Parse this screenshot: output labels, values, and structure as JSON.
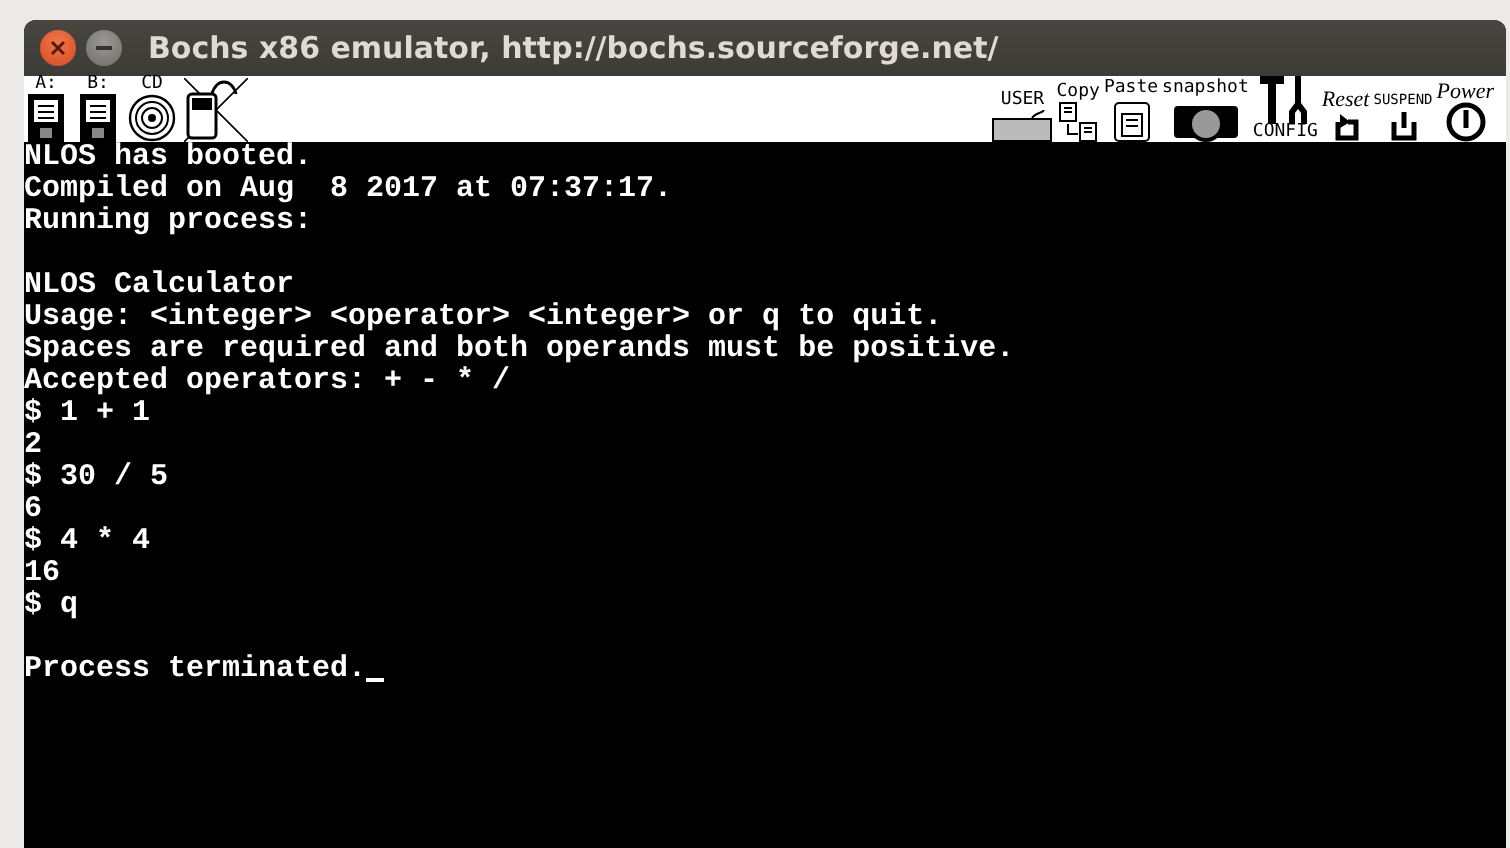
{
  "window": {
    "title": "Bochs x86 emulator, http://bochs.sourceforge.net/"
  },
  "toolbar": {
    "left": [
      {
        "kind": "floppy",
        "label": "A:"
      },
      {
        "kind": "floppy",
        "label": "B:"
      },
      {
        "kind": "cdrom",
        "label": "CD"
      },
      {
        "kind": "mouse"
      }
    ],
    "right": [
      {
        "kind": "user",
        "label": "USER"
      },
      {
        "kind": "copy",
        "label": "Copy"
      },
      {
        "kind": "paste",
        "label": "Paste"
      },
      {
        "kind": "snapshot",
        "label": "snapshot"
      },
      {
        "kind": "config",
        "label": "CONFIG"
      },
      {
        "kind": "reset",
        "label": "Reset"
      },
      {
        "kind": "suspend",
        "label": "SUSPEND"
      },
      {
        "kind": "power",
        "label": "Power"
      }
    ]
  },
  "terminal": {
    "lines": [
      {
        "kind": "text",
        "text": "NLOS has booted."
      },
      {
        "kind": "text",
        "text": "Compiled on Aug  8 2017 at 07:37:17."
      },
      {
        "kind": "text",
        "text": "Running process:"
      },
      {
        "kind": "blank"
      },
      {
        "kind": "text",
        "text": "NLOS Calculator"
      },
      {
        "kind": "text",
        "text": "Usage: <integer> <operator> <integer> or q to quit."
      },
      {
        "kind": "text",
        "text": "Spaces are required and both operands must be positive."
      },
      {
        "kind": "text",
        "text": "Accepted operators: + - * /"
      },
      {
        "kind": "text",
        "text": "$ 1 + 1"
      },
      {
        "kind": "text",
        "text": "2"
      },
      {
        "kind": "text",
        "text": "$ 30 / 5"
      },
      {
        "kind": "text",
        "text": "6"
      },
      {
        "kind": "text",
        "text": "$ 4 * 4"
      },
      {
        "kind": "text",
        "text": "16"
      },
      {
        "kind": "text",
        "text": "$ q"
      },
      {
        "kind": "blank"
      },
      {
        "kind": "text",
        "text": "Process terminated."
      }
    ],
    "cursor": true
  }
}
